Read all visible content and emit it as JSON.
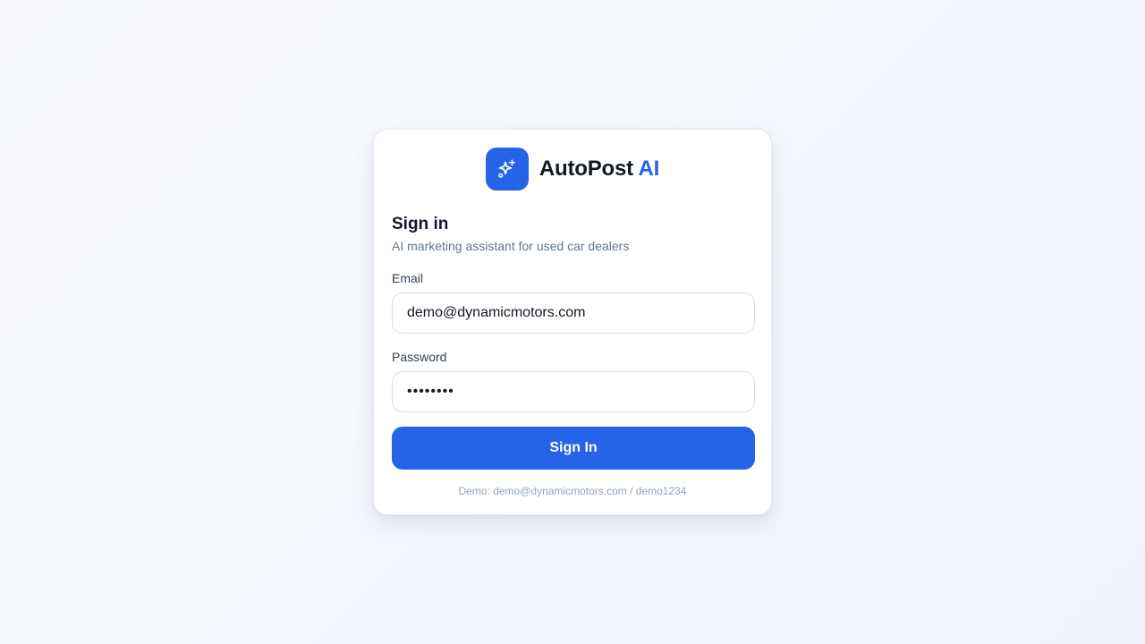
{
  "brand": {
    "logo_icon": "sparkles-icon",
    "name": "AutoPost",
    "accent": "AI"
  },
  "signin": {
    "heading": "Sign in",
    "subtitle": "AI marketing assistant for used car dealers",
    "email_label": "Email",
    "email_value": "demo@dynamicmotors.com",
    "password_label": "Password",
    "password_value": "demo1234",
    "button_label": "Sign In",
    "demo_note": "Demo: demo@dynamicmotors.com / demo1234"
  },
  "colors": {
    "accent": "#2563e7",
    "text": "#111827",
    "muted": "#64748b",
    "note": "#94a3b8"
  }
}
